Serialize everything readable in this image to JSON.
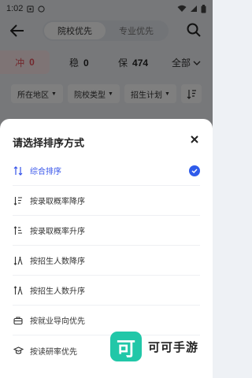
{
  "status": {
    "time": "1:02"
  },
  "header": {
    "tabs": [
      {
        "label": "院校优先"
      },
      {
        "label": "专业优先"
      }
    ]
  },
  "stats": {
    "chong": {
      "label": "冲",
      "value": "0"
    },
    "wen": {
      "label": "稳",
      "value": "0"
    },
    "bao": {
      "label": "保",
      "value": "474"
    },
    "all": {
      "label": "全部"
    }
  },
  "filters": [
    {
      "label": "所在地区"
    },
    {
      "label": "院校类型"
    },
    {
      "label": "招生计划"
    }
  ],
  "sheet": {
    "title": "请选择排序方式",
    "options": [
      {
        "label": "综合排序",
        "icon": "sort-arrows-icon",
        "selected": true
      },
      {
        "label": "按录取概率降序",
        "icon": "sort-desc-icon",
        "selected": false
      },
      {
        "label": "按录取概率升序",
        "icon": "sort-asc-icon",
        "selected": false
      },
      {
        "label": "按招生人数降序",
        "icon": "people-desc-icon",
        "selected": false
      },
      {
        "label": "按招生人数升序",
        "icon": "people-asc-icon",
        "selected": false
      },
      {
        "label": "按就业导向优先",
        "icon": "briefcase-icon",
        "selected": false
      },
      {
        "label": "按读研率优先",
        "icon": "graduation-cap-icon",
        "selected": false
      }
    ]
  },
  "watermark": {
    "badge": "可",
    "text": "可可手游"
  },
  "colors": {
    "accent": "#2f5bea",
    "chong": "#e4505a",
    "brand": "#21c7a8"
  }
}
